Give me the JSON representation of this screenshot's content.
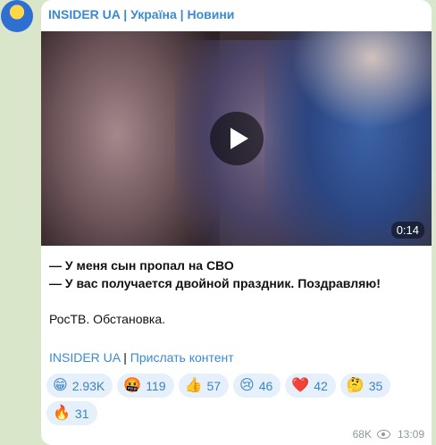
{
  "channel": {
    "name": "INSIDER UA | Україна | Новини"
  },
  "video": {
    "duration": "0:14",
    "play_icon": "play-icon"
  },
  "message": {
    "line1": "— У меня сын пропал на СВО",
    "line2": "— У вас получается двойной праздник. Поздравляю!",
    "line3": "РосТВ. Обстановка."
  },
  "links": {
    "channel_link": "INSIDER UA",
    "separator": "|",
    "submit_link": "Прислать контент"
  },
  "reactions": [
    {
      "emoji": "😁",
      "count": "2.93K",
      "icon": "grinning-face-icon"
    },
    {
      "emoji": "🤬",
      "count": "119",
      "icon": "swearing-face-icon"
    },
    {
      "emoji": "👍",
      "count": "57",
      "icon": "thumbs-up-icon"
    },
    {
      "emoji": "😢",
      "count": "46",
      "icon": "crying-face-icon"
    },
    {
      "emoji": "❤️",
      "count": "42",
      "icon": "red-heart-icon"
    },
    {
      "emoji": "🤔",
      "count": "35",
      "icon": "thinking-face-icon"
    },
    {
      "emoji": "🔥",
      "count": "31",
      "icon": "fire-icon"
    }
  ],
  "meta": {
    "views": "68K",
    "time": "13:09"
  },
  "colors": {
    "accent": "#3a8ad1",
    "background": "#d9e6c9",
    "reaction_bg": "#e6f0fa"
  }
}
